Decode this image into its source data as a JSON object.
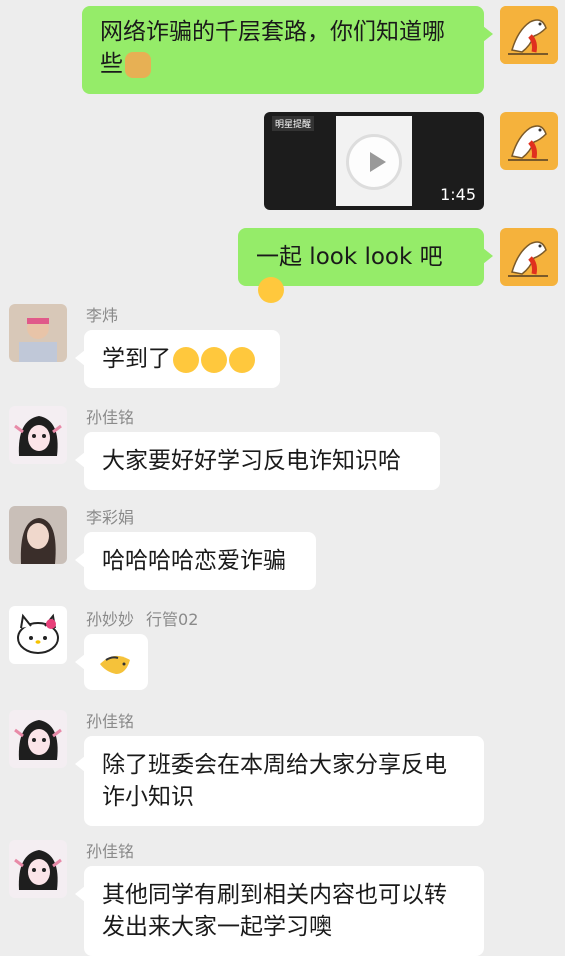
{
  "messages": [
    {
      "sender": "",
      "text": "网络诈骗的千层套路，你们知道哪些"
    },
    {
      "sender": "",
      "video": {
        "duration": "1:45",
        "caption": "明星提醒"
      }
    },
    {
      "sender": "",
      "text": "一起 look look 吧"
    },
    {
      "sender": "李炜",
      "text": "学到了"
    },
    {
      "sender": "孙佳铭",
      "text": "大家要好好学习反电诈知识哈"
    },
    {
      "sender": "李彩娟",
      "text": "哈哈哈哈恋爱诈骗"
    },
    {
      "sender": "孙妙妙",
      "tag": "行管02",
      "text": ""
    },
    {
      "sender": "孙佳铭",
      "text": "除了班委会在本周给大家分享反电诈小知识"
    },
    {
      "sender": "孙佳铭",
      "text": "其他同学有刷到相关内容也可以转发出来大家一起学习噢"
    }
  ],
  "colors": {
    "background": "#ededed",
    "outgoing_bubble": "#95ec69",
    "incoming_bubble": "#ffffff",
    "sender_name": "#8a8a8a"
  }
}
